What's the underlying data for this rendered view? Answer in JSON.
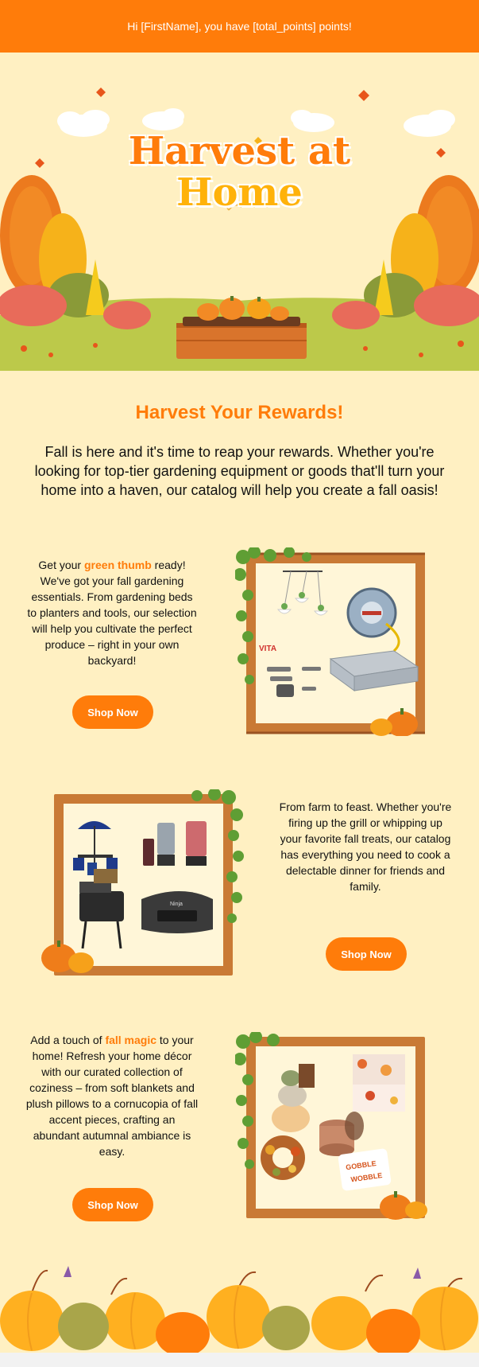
{
  "topbar": {
    "greeting": "Hi [FirstName], you have [total_points] points!"
  },
  "hero": {
    "title_line1": "Harvest at",
    "title_line2": "Home"
  },
  "main": {
    "heading": "Harvest Your Rewards!",
    "intro": "Fall is here and it's time to reap your rewards. Whether you're looking for top-tier gardening equipment or goods that'll turn your home into a haven, our catalog will help you create a fall oasis!"
  },
  "features": [
    {
      "text_before": "Get your ",
      "accent": "green thumb",
      "text_after": " ready! We've got your fall gardening essentials. From gardening beds to planters and tools, our selection will help you cultivate the perfect produce – right in your own backyard!",
      "button": "Shop Now",
      "image_brand": "VITA"
    },
    {
      "text": "From farm to feast. Whether you're firing up the grill or whipping up your favorite fall treats, our catalog has everything you need to cook a delectable dinner for friends and family.",
      "button": "Shop Now",
      "image_brand": "Ninja"
    },
    {
      "text_before": "Add a touch of ",
      "accent": "fall magic",
      "text_after": " to your home! Refresh your home décor with our curated collection of coziness – from soft blankets and plush pillows to a cornucopia of fall accent pieces, crafting an abundant autumnal ambiance is easy.",
      "button": "Shop Now",
      "pillow_text_1": "GOBBLE",
      "pillow_text_2": "WOBBLE"
    }
  ],
  "colors": {
    "brand_orange": "#ff7c0a",
    "brand_yellow": "#ffb20a",
    "background": "#fff0c2"
  }
}
